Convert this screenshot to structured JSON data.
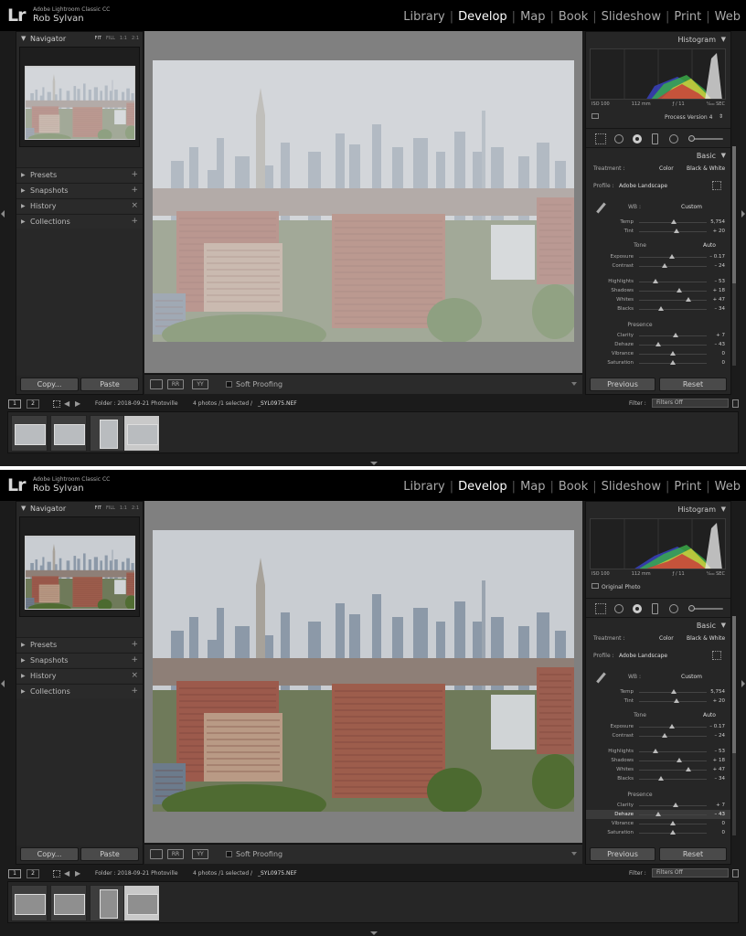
{
  "app": {
    "logo": "Lr",
    "name": "Adobe Lightroom Classic CC",
    "user": "Rob Sylvan"
  },
  "modules": [
    "Library",
    "Develop",
    "Map",
    "Book",
    "Slideshow",
    "Print",
    "Web"
  ],
  "active_module": "Develop",
  "navigator": {
    "title": "Navigator",
    "zooms": [
      "FIT",
      "FILL",
      "1:1",
      "2:1"
    ]
  },
  "left_panels": [
    {
      "label": "Presets",
      "action": "+"
    },
    {
      "label": "Snapshots",
      "action": "+"
    },
    {
      "label": "History",
      "action": "×"
    },
    {
      "label": "Collections",
      "action": "+"
    }
  ],
  "left_buttons": {
    "copy": "Copy...",
    "paste": "Paste"
  },
  "toolbar": {
    "soft_proofing": "Soft Proofing"
  },
  "histogram": {
    "title": "Histogram",
    "iso": "ISO 100",
    "focal": "112 mm",
    "aperture": "ƒ / 11",
    "shutter": "¹⁄₂₀₀ SEC"
  },
  "basic": {
    "title": "Basic",
    "treatment_label": "Treatment :",
    "color": "Color",
    "bw": "Black & White",
    "profile_label": "Profile :",
    "profile": "Adobe Landscape",
    "wb_label": "WB :",
    "wb": "Custom",
    "tone_label": "Tone",
    "auto": "Auto",
    "presence_label": "Presence"
  },
  "sliders_wb": [
    {
      "label": "Temp",
      "value": "5,754",
      "pos": 0.52
    },
    {
      "label": "Tint",
      "value": "+ 20",
      "pos": 0.56
    }
  ],
  "sliders_tone": [
    {
      "label": "Exposure",
      "value": "– 0.17",
      "pos": 0.48
    },
    {
      "label": "Contrast",
      "value": "– 24",
      "pos": 0.38
    }
  ],
  "sliders_tone2": [
    {
      "label": "Highlights",
      "value": "– 53",
      "pos": 0.24
    },
    {
      "label": "Shadows",
      "value": "+ 18",
      "pos": 0.59
    },
    {
      "label": "Whites",
      "value": "+ 47",
      "pos": 0.73
    },
    {
      "label": "Blacks",
      "value": "– 34",
      "pos": 0.33
    }
  ],
  "sliders_presence": [
    {
      "label": "Clarity",
      "value": "+ 7",
      "pos": 0.54
    },
    {
      "label": "Dehaze",
      "value": "– 43",
      "pos": 0.28
    },
    {
      "label": "Vibrance",
      "value": "0",
      "pos": 0.5
    },
    {
      "label": "Saturation",
      "value": "0",
      "pos": 0.5
    }
  ],
  "right_buttons": {
    "previous": "Previous",
    "reset": "Reset"
  },
  "filmstrip": {
    "pages": [
      "1",
      "2"
    ],
    "folder": "Folder : 2018-09-21 Photoville",
    "count": "4 photos /1 selected /",
    "file": "_SYL0975.NEF",
    "filter_label": "Filter :",
    "filter_value": "Filters Off"
  },
  "states": [
    {
      "status": "Process Version 4",
      "dehaze_highlight": false,
      "haze": 0.45
    },
    {
      "status": "Original Photo",
      "dehaze_highlight": true,
      "haze": 0.0
    }
  ]
}
